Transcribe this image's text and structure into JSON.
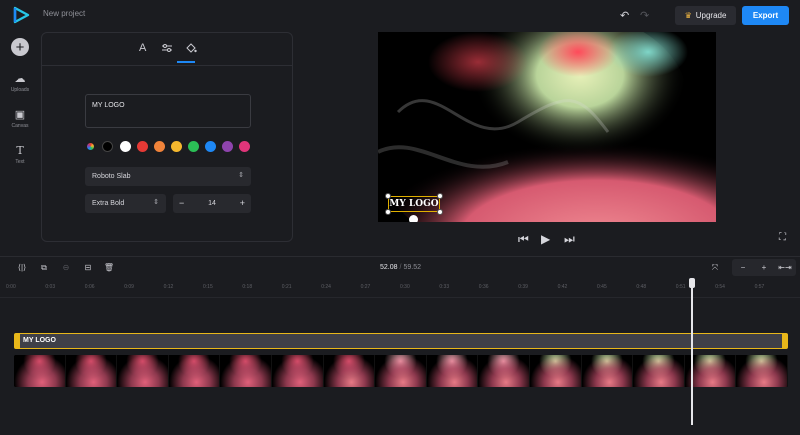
{
  "app": {
    "project_title": "New project"
  },
  "header": {
    "upgrade_label": "Upgrade",
    "export_label": "Export"
  },
  "sidebar": {
    "items": [
      {
        "label": "Uploads",
        "icon": "cloud-upload-icon"
      },
      {
        "label": "Canvas",
        "icon": "canvas-icon"
      },
      {
        "label": "Text",
        "icon": "text-icon"
      }
    ]
  },
  "text_panel": {
    "tabs": [
      {
        "label": "A",
        "icon": "text-style-icon",
        "active": true
      },
      {
        "icon": "adjust-icon"
      },
      {
        "icon": "fill-icon"
      }
    ],
    "text_value": "MY LOGO",
    "colors": [
      "#000000",
      "#ffffff",
      "#e53935",
      "#f0833a",
      "#f5b82e",
      "#2bbf56",
      "#1e88f5",
      "#8e44ad",
      "#e0357a"
    ],
    "font_family": "Roboto Slab",
    "font_weight": "Extra Bold",
    "font_size": "14"
  },
  "preview": {
    "overlay_text": "MY LOGO"
  },
  "timeline": {
    "current_time": "52.08",
    "total_time": "59.52",
    "ticks": [
      "0:00",
      "0:03",
      "0:06",
      "0:09",
      "0:12",
      "0:15",
      "0:18",
      "0:21",
      "0:24",
      "0:27",
      "0:30",
      "0:33",
      "0:36",
      "0:39",
      "0:42",
      "0:45",
      "0:48",
      "0:51",
      "0:54",
      "0:57"
    ],
    "text_clip_label": "MY LOGO",
    "playhead_fraction": 0.875
  },
  "accent": "#1e88f5",
  "selection_color": "#e8b71a"
}
